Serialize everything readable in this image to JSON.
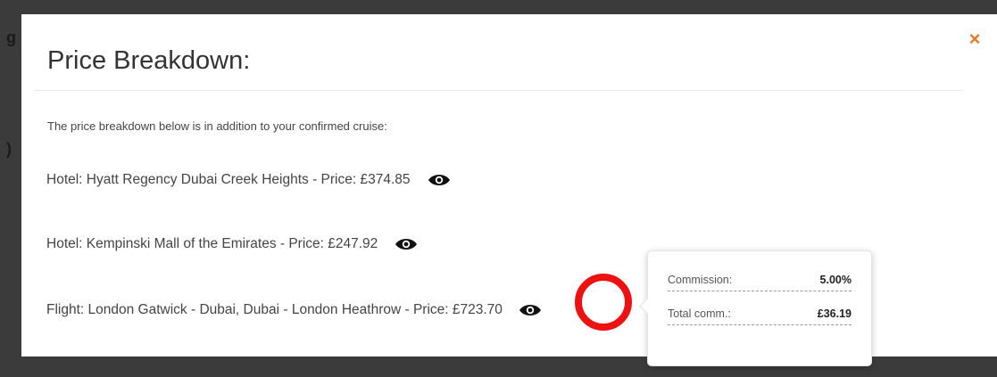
{
  "modal": {
    "title": "Price Breakdown:",
    "close_icon": "×",
    "intro": "The price breakdown below is in addition to your confirmed cruise:",
    "items": [
      {
        "text": "Hotel: Hyatt Regency Dubai Creek Heights - Price: £374.85",
        "icon": "eye-icon"
      },
      {
        "text": "Hotel: Kempinski Mall of the Emirates - Price: £247.92",
        "icon": "eye-icon"
      },
      {
        "text": "Flight: London Gatwick - Dubai, Dubai - London Heathrow - Price: £723.70",
        "icon": "eye-icon"
      }
    ]
  },
  "popover": {
    "rows": [
      {
        "label": "Commission:",
        "value": "5.00%"
      },
      {
        "label": "Total comm.:",
        "value": "£36.19"
      }
    ]
  },
  "colors": {
    "accent": "#e8782a",
    "highlight": "#ee1111",
    "backdrop": "#3b3b3b"
  }
}
